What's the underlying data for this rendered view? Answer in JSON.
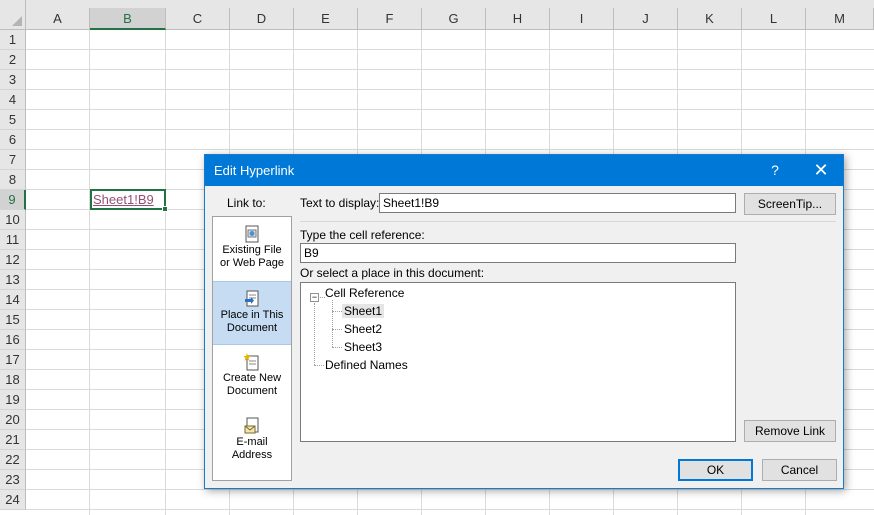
{
  "sheet": {
    "columns": [
      "A",
      "B",
      "C",
      "D",
      "E",
      "F",
      "G",
      "H",
      "I",
      "J",
      "K",
      "L",
      "M"
    ],
    "rows": [
      "1",
      "2",
      "3",
      "4",
      "5",
      "6",
      "7",
      "8",
      "9",
      "10",
      "11",
      "12",
      "13",
      "14",
      "15",
      "16",
      "17",
      "18",
      "19",
      "20",
      "21",
      "22",
      "23",
      "24"
    ],
    "selected_column": "B",
    "selected_row": "9",
    "cell_b9_text": "Sheet1!B9",
    "hyperlink_color": "#954f72",
    "accent": "#217346"
  },
  "dialog": {
    "title": "Edit Hyperlink",
    "help_glyph": "?",
    "close_glyph": "✕",
    "link_to_label": "Link to:",
    "link_to_items": [
      {
        "line1": "Existing File",
        "line2": "or Web Page",
        "icon": "existing-file-icon"
      },
      {
        "line1": "Place in This",
        "line2": "Document",
        "icon": "place-in-document-icon"
      },
      {
        "line1": "Create New",
        "line2": "Document",
        "icon": "create-new-document-icon"
      },
      {
        "line1": "E-mail",
        "line2": "Address",
        "icon": "email-address-icon"
      }
    ],
    "selected_link_to": "Place in This Document",
    "text_to_display_label": "Text to display:",
    "text_to_display_value": "Sheet1!B9",
    "screentip_label": "ScreenTip...",
    "cell_reference_label": "Type the cell reference:",
    "cell_reference_value": "B9",
    "select_place_label": "Or select a place in this document:",
    "tree": {
      "expander_glyph": "−",
      "root": "Cell Reference",
      "sheets": [
        "Sheet1",
        "Sheet2",
        "Sheet3"
      ],
      "selected_sheet": "Sheet1",
      "defined_names": "Defined Names"
    },
    "remove_link_label": "Remove Link",
    "ok_label": "OK",
    "cancel_label": "Cancel",
    "accent": "#0078d7"
  }
}
